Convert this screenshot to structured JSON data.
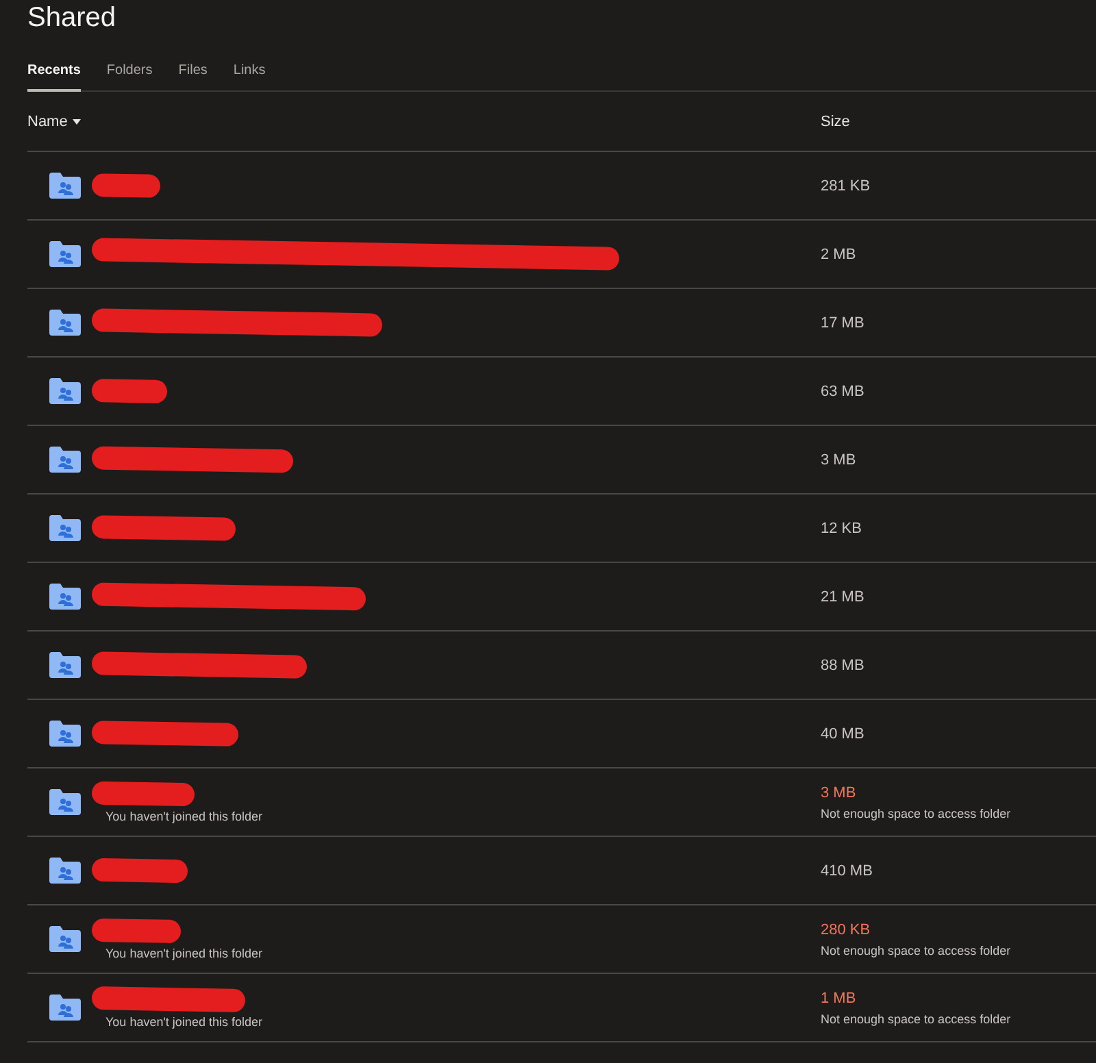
{
  "title": "Shared",
  "tabs": [
    {
      "label": "Recents",
      "selected": true
    },
    {
      "label": "Folders",
      "selected": false
    },
    {
      "label": "Files",
      "selected": false
    },
    {
      "label": "Links",
      "selected": false
    }
  ],
  "columns": [
    {
      "label": "Name",
      "sorted": true
    },
    {
      "label": "Size",
      "sorted": false
    }
  ],
  "rows": [
    {
      "redacted": true,
      "size": "281 KB",
      "over_quota": false
    },
    {
      "redacted": true,
      "size": "2 MB",
      "over_quota": false
    },
    {
      "redacted": true,
      "size": "17 MB",
      "over_quota": false
    },
    {
      "redacted": true,
      "size": "63 MB",
      "over_quota": false
    },
    {
      "redacted": true,
      "size": "3 MB",
      "over_quota": false
    },
    {
      "redacted": true,
      "size": "12 KB",
      "over_quota": false
    },
    {
      "redacted": true,
      "size": "21 MB",
      "over_quota": false
    },
    {
      "redacted": true,
      "size": "88 MB",
      "over_quota": false
    },
    {
      "redacted": true,
      "size": "40 MB",
      "over_quota": false
    },
    {
      "redacted": true,
      "note": "You haven't joined this folder",
      "size": "3 MB",
      "over_quota": true,
      "size_note": "Not enough space to access folder"
    },
    {
      "redacted": true,
      "size": "410 MB",
      "over_quota": false
    },
    {
      "redacted": true,
      "note": "You haven't joined this folder",
      "size": "280 KB",
      "over_quota": true,
      "size_note": "Not enough space to access folder"
    },
    {
      "redacted": true,
      "note": "You haven't joined this folder",
      "size": "1 MB",
      "over_quota": true,
      "size_note": "Not enough space to access folder"
    }
  ]
}
